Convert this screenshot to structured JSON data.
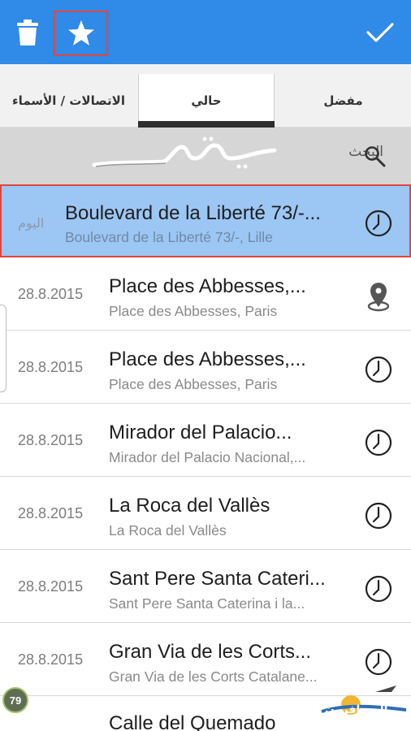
{
  "toolbar": {
    "delete_icon": "trash-icon",
    "favorite_icon": "star-icon",
    "confirm_icon": "check-icon",
    "bar_color": "#2f8ae8",
    "highlight_color": "#e0463f"
  },
  "tabs": [
    {
      "label": "الاتصالات / الأسماء"
    },
    {
      "label": "حالي",
      "active": true
    },
    {
      "label": "مفضل"
    }
  ],
  "search": {
    "label": "البحث",
    "icon": "search-icon",
    "watermark": "تميمه"
  },
  "rows": [
    {
      "date": "اليوم",
      "title": "Boulevard de la Liberté 73/-...",
      "subtitle": "Boulevard de la Liberté 73/-, Lille",
      "icon": "clock-icon",
      "selected": true
    },
    {
      "date": "28.8.2015",
      "title": "Place des Abbesses,...",
      "subtitle": "Place des Abbesses, Paris",
      "icon": "location-pin-icon"
    },
    {
      "date": "28.8.2015",
      "title": "Place des Abbesses,...",
      "subtitle": "Place des Abbesses, Paris",
      "icon": "clock-icon"
    },
    {
      "date": "28.8.2015",
      "title": "Mirador del Palacio...",
      "subtitle": "Mirador del Palacio Nacional,...",
      "icon": "clock-icon"
    },
    {
      "date": "28.8.2015",
      "title": "La Roca del Vallès",
      "subtitle": "La Roca del Vallès",
      "icon": "clock-icon"
    },
    {
      "date": "28.8.2015",
      "title": "Sant Pere Santa Cateri...",
      "subtitle": "Sant Pere Santa Caterina i la...",
      "icon": "clock-icon"
    },
    {
      "date": "28.8.2015",
      "title": "Gran Via de les Corts...",
      "subtitle": "Gran Via de les Corts Catalane...",
      "icon": "clock-icon"
    },
    {
      "date": "",
      "title": "Calle del Quemado",
      "subtitle": "",
      "icon": ""
    }
  ],
  "overlay": {
    "badge": "79",
    "logo_text": "المسافرون"
  }
}
